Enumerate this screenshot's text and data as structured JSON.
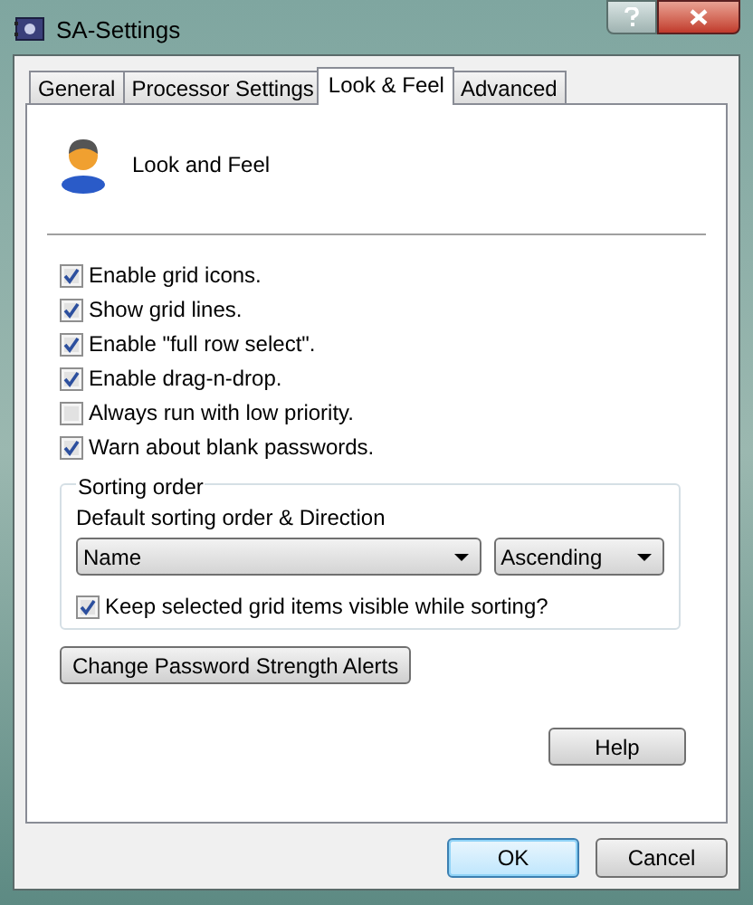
{
  "window": {
    "title": "SA-Settings"
  },
  "tabs": [
    {
      "label": "General",
      "selected": false
    },
    {
      "label": "Processor Settings",
      "selected": false
    },
    {
      "label": "Look & Feel",
      "selected": true
    },
    {
      "label": "Advanced",
      "selected": false
    }
  ],
  "header": {
    "title": "Look and Feel"
  },
  "options": [
    {
      "label": "Enable grid icons.",
      "checked": true
    },
    {
      "label": "Show grid lines.",
      "checked": true
    },
    {
      "label": "Enable \"full row select\".",
      "checked": true
    },
    {
      "label": "Enable drag-n-drop.",
      "checked": true
    },
    {
      "label": "Always run with low priority.",
      "checked": false
    },
    {
      "label": "Warn about blank passwords.",
      "checked": true
    }
  ],
  "sorting_order": {
    "title": "Sorting order",
    "label": "Default sorting order & Direction",
    "dropdowns": [
      {
        "value": "Name"
      },
      {
        "value": "Ascending"
      }
    ],
    "keep_visible": {
      "label": "Keep selected grid items visible while sorting?",
      "checked": true
    }
  },
  "password_button": "Change Password Strength Alerts",
  "help_button": "Help",
  "footer_buttons": [
    {
      "label": "OK",
      "default": true
    },
    {
      "label": "Cancel",
      "default": false
    }
  ]
}
